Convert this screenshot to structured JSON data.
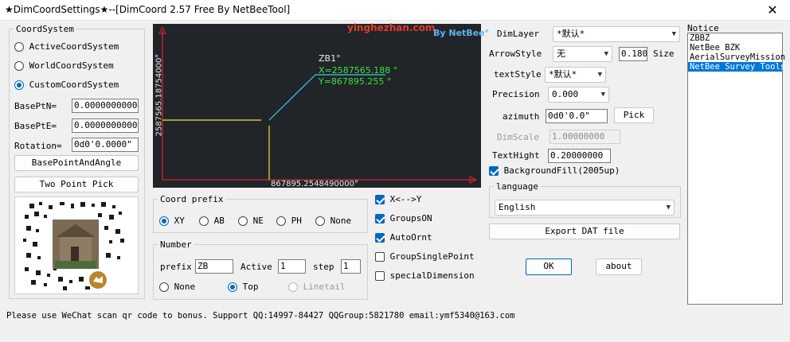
{
  "window": {
    "title": "★DimCoordSettings★--[DimCoord 2.57 Free By NetBeeTool]",
    "close": "✕"
  },
  "coord_system": {
    "label": "CoordSystem",
    "options": [
      {
        "label": "ActiveCoordSystem",
        "checked": false
      },
      {
        "label": "WorldCoordSystem",
        "checked": false
      },
      {
        "label": "CustomCoordSystem",
        "checked": true
      }
    ],
    "base_n_label": "BasePtN=",
    "base_n_value": "0.000000000000",
    "base_e_label": "BasePtE=",
    "base_e_value": "0.000000000000",
    "rotation_label": "Rotation=",
    "rotation_value": "0d0'0.0000\"",
    "base_point_button": "BasePointAndAngle",
    "two_point_button": "Two Point Pick"
  },
  "preview": {
    "watermark": "yinghezhan.com",
    "logo": "By NetBee°",
    "point_name": "ZB1°",
    "x_text": "X=2587565.188 °",
    "y_text": "Y=867895.255 °",
    "vertical_axis_label": "2587565.18754000°",
    "horizontal_axis_label": "867895.2548490000°",
    "colors": {
      "background": "#21252a",
      "axis": "#d9262a",
      "lead": "#e8e23c",
      "leader": "#42c7e8",
      "text_green": "#3be03b"
    }
  },
  "coord_prefix": {
    "label": "Coord prefix",
    "options": [
      {
        "label": "XY",
        "checked": true
      },
      {
        "label": "AB",
        "checked": false
      },
      {
        "label": "NE",
        "checked": false
      },
      {
        "label": "PH",
        "checked": false
      },
      {
        "label": "None",
        "checked": false
      }
    ]
  },
  "number": {
    "label": "Number",
    "prefix_label": "prefix",
    "prefix_value": "ZB",
    "active_label": "Active",
    "active_value": "1",
    "step_label": "step",
    "step_value": "1",
    "options": [
      {
        "label": "None",
        "checked": false,
        "disabled": false
      },
      {
        "label": "Top",
        "checked": true,
        "disabled": false
      },
      {
        "label": "Linetail",
        "checked": false,
        "disabled": true
      }
    ]
  },
  "checks": [
    {
      "label": "X<-->Y",
      "checked": true
    },
    {
      "label": "GroupsON",
      "checked": true
    },
    {
      "label": "AutoOrnt",
      "checked": true
    },
    {
      "label": "GroupSinglePoint",
      "checked": false
    },
    {
      "label": "specialDimension",
      "checked": false
    }
  ],
  "settings": {
    "dimlayer_label": "DimLayer",
    "dimlayer_value": "*默认*",
    "arrowstyle_label": "ArrowStyle",
    "arrowstyle_value": "无",
    "arrow_size_value": "0.1800",
    "size_label": "Size",
    "textstyle_label": "textStyle",
    "textstyle_value": "*默认*",
    "precision_label": "Precision",
    "precision_value": "0.000",
    "azimuth_label": "azimuth",
    "azimuth_value": "0d0'0.0\"",
    "pick_button": "Pick",
    "dimscale_label": "DimScale",
    "dimscale_value": "1.00000000",
    "texthight_label": "TextHight",
    "texthight_value": "0.20000000",
    "background_fill_label": "BackgroundFill(2005up)",
    "background_fill_checked": true,
    "language_label": "language",
    "language_value": "English",
    "export_button": "Export DAT file",
    "ok_button": "OK",
    "about_button": "about"
  },
  "notice": {
    "label": "Notice",
    "items": [
      {
        "label": "ZBBZ",
        "selected": false
      },
      {
        "label": "NetBee BZK",
        "selected": false
      },
      {
        "label": "AerialSurveyMission",
        "selected": false
      },
      {
        "label": "NetBee Survey Tools",
        "selected": true
      }
    ]
  },
  "footer": {
    "text": "Please use WeChat scan qr code to bonus. Support QQ:14997-84427 QQGroup:5821780 email:ymf5340@163.com"
  }
}
